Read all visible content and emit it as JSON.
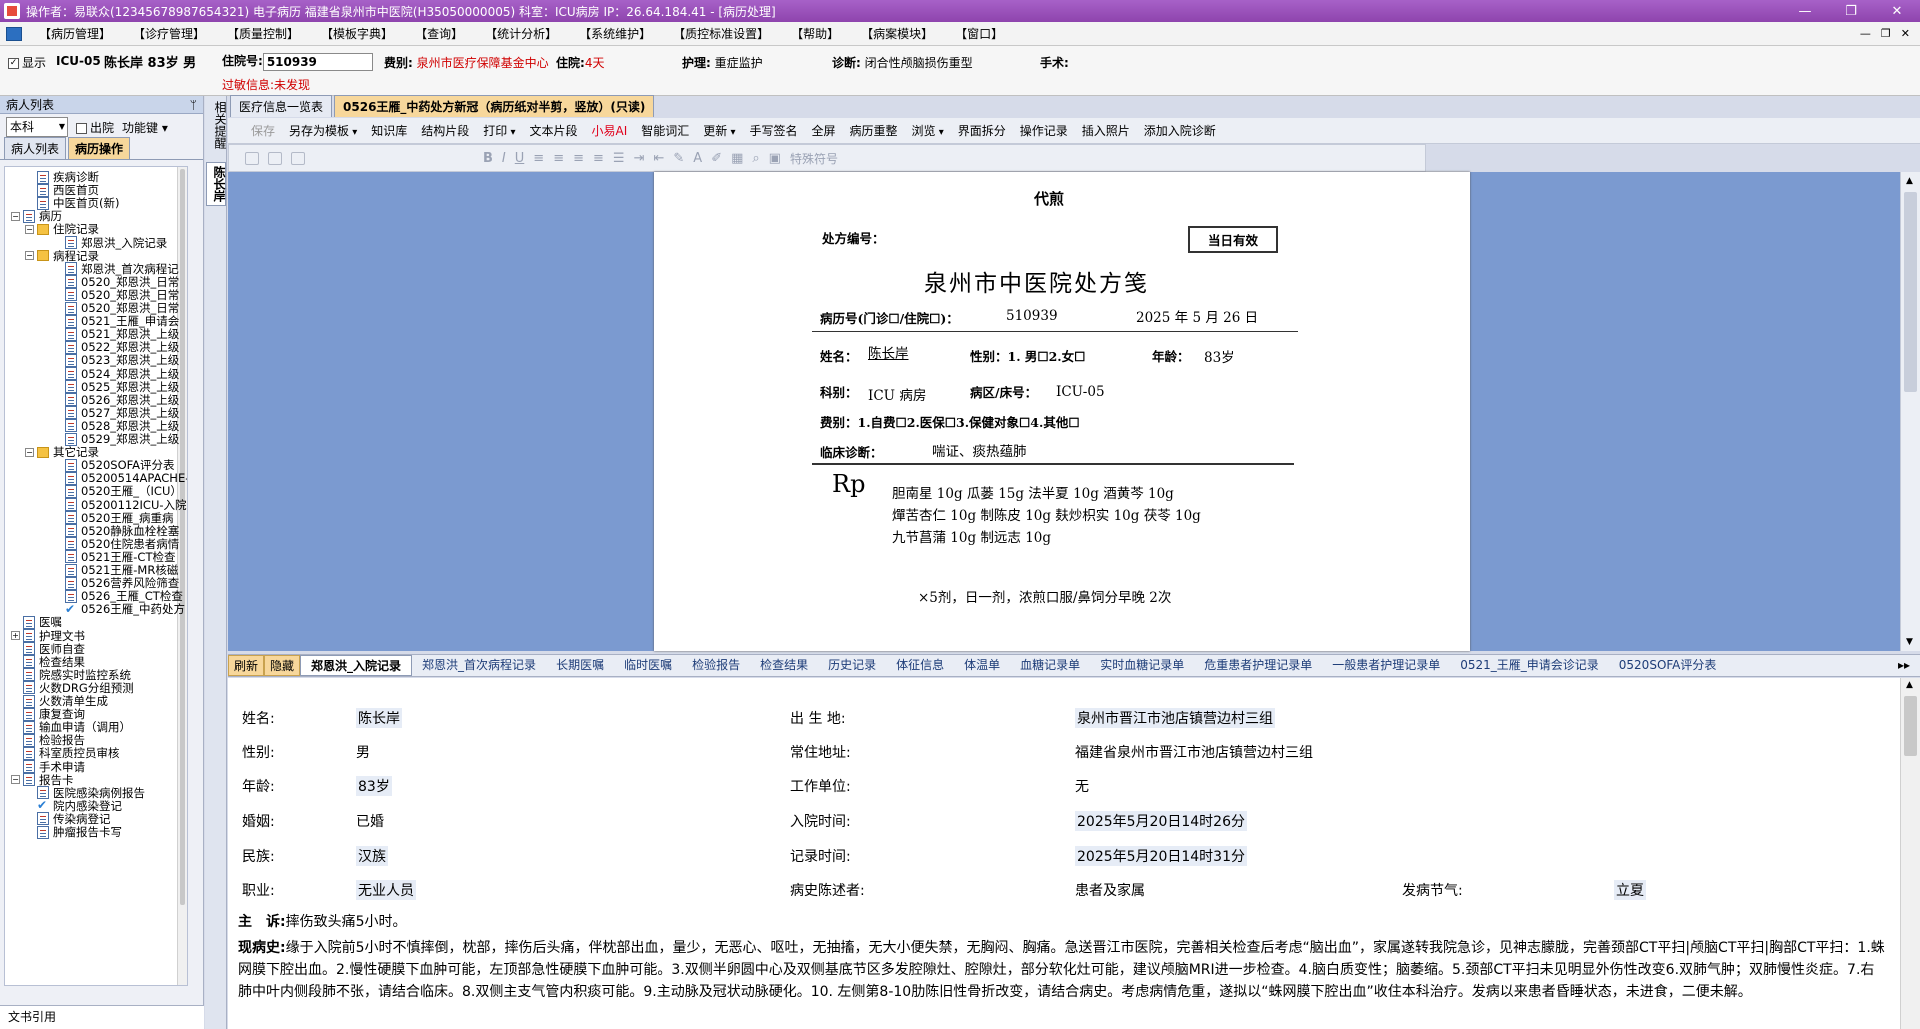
{
  "titlebar": {
    "text": "操作者：易联众(12345678987654321) 电子病历  福建省泉州市中医院(H35050000005)  科室：ICU病房  IP：26.64.184.41 - [病历处理]",
    "min": "—",
    "max": "❐",
    "close": "✕"
  },
  "menu": [
    "【病历管理】",
    "【诊疗管理】",
    "【质量控制】",
    "【模板字典】",
    "【查询】",
    "【统计分析】",
    "【系统维护】",
    "【质控标准设置】",
    "【帮助】",
    "【病案模块】",
    "【窗口】"
  ],
  "menu_right": [
    "—",
    "❐",
    "✕"
  ],
  "patient": {
    "show_label": "显示",
    "bed": "ICU-05",
    "name_age_sex": "陈长岸 83岁 男",
    "zyh_label": "住院号:",
    "zyh": "510939",
    "fb_label": "费别:",
    "fb": "泉州市医疗保障基金中心",
    "zy_label": "住院:",
    "zy_days": "4天",
    "hl_label": "护理:",
    "hl": "重症监护",
    "zd_label": "诊断:",
    "zd": "闭合性颅脑损伤重型",
    "ss_label": "手术:",
    "gm_label": "过敏信息:",
    "gm": "未发现"
  },
  "left": {
    "header": "病人列表",
    "pin": "ᛘ",
    "dept": "本科",
    "discharged": "出院",
    "funckey": "功能键",
    "tabs": [
      "病人列表",
      "病历操作"
    ],
    "tree": [
      {
        "label": "疾病诊断",
        "lv": 1,
        "icon": "doc"
      },
      {
        "label": "西医首页",
        "lv": 1,
        "icon": "doc"
      },
      {
        "label": "中医首页(新)",
        "lv": 1,
        "icon": "doc"
      },
      {
        "label": "病历",
        "lv": 0,
        "icon": "doc",
        "exp": "−"
      },
      {
        "label": "住院记录",
        "lv": 1,
        "icon": "folder",
        "exp": "−"
      },
      {
        "label": "郑恩洪_入院记录",
        "lv": 3,
        "icon": "doc"
      },
      {
        "label": "病程记录",
        "lv": 1,
        "icon": "folder",
        "exp": "−"
      },
      {
        "label": "郑恩洪_首次病程记",
        "lv": 3,
        "icon": "doc"
      },
      {
        "label": "0520_郑恩洪_日常",
        "lv": 3,
        "icon": "doc"
      },
      {
        "label": "0520_郑恩洪_日常",
        "lv": 3,
        "icon": "doc"
      },
      {
        "label": "0520_郑恩洪_日常",
        "lv": 3,
        "icon": "doc"
      },
      {
        "label": "0521_王雁_申请会",
        "lv": 3,
        "icon": "doc"
      },
      {
        "label": "0521_郑恩洪_上级",
        "lv": 3,
        "icon": "doc"
      },
      {
        "label": "0522_郑恩洪_上级",
        "lv": 3,
        "icon": "doc"
      },
      {
        "label": "0523_郑恩洪_上级",
        "lv": 3,
        "icon": "doc"
      },
      {
        "label": "0524_郑恩洪_上级",
        "lv": 3,
        "icon": "doc"
      },
      {
        "label": "0525_郑恩洪_上级",
        "lv": 3,
        "icon": "doc"
      },
      {
        "label": "0526_郑恩洪_上级",
        "lv": 3,
        "icon": "doc"
      },
      {
        "label": "0527_郑恩洪_上级",
        "lv": 3,
        "icon": "doc"
      },
      {
        "label": "0528_郑恩洪_上级",
        "lv": 3,
        "icon": "doc"
      },
      {
        "label": "0529_郑恩洪_上级",
        "lv": 3,
        "icon": "doc"
      },
      {
        "label": "其它记录",
        "lv": 1,
        "icon": "folder",
        "exp": "−"
      },
      {
        "label": "0520SOFA评分表",
        "lv": 3,
        "icon": "doc"
      },
      {
        "label": "05200514APACHE-J",
        "lv": 3,
        "icon": "doc"
      },
      {
        "label": "0520王雁_（ICU）",
        "lv": 3,
        "icon": "doc"
      },
      {
        "label": "05200112ICU-入院",
        "lv": 3,
        "icon": "doc"
      },
      {
        "label": "0520王雁_病重病",
        "lv": 3,
        "icon": "doc"
      },
      {
        "label": "0520静脉血栓栓塞",
        "lv": 3,
        "icon": "doc"
      },
      {
        "label": "0520住院患者病情",
        "lv": 3,
        "icon": "doc"
      },
      {
        "label": "0521王雁-CT检查",
        "lv": 3,
        "icon": "doc"
      },
      {
        "label": "0521王雁-MR核磁",
        "lv": 3,
        "icon": "doc"
      },
      {
        "label": "0526营养风险筛查",
        "lv": 3,
        "icon": "doc"
      },
      {
        "label": "0526_王雁_CT检查",
        "lv": 3,
        "icon": "doc"
      },
      {
        "label": "0526王雁_中药处方",
        "lv": 3,
        "icon": "check"
      },
      {
        "label": "医嘱",
        "lv": 0,
        "icon": "doc"
      },
      {
        "label": "护理文书",
        "lv": 0,
        "icon": "doc",
        "exp": "+"
      },
      {
        "label": "医师自查",
        "lv": 0,
        "icon": "doc"
      },
      {
        "label": "检查结果",
        "lv": 0,
        "icon": "doc"
      },
      {
        "label": "院感实时监控系统",
        "lv": 0,
        "icon": "doc"
      },
      {
        "label": "火数DRG分组预测",
        "lv": 0,
        "icon": "doc"
      },
      {
        "label": "火数清单生成",
        "lv": 0,
        "icon": "doc"
      },
      {
        "label": "康复查询",
        "lv": 0,
        "icon": "doc"
      },
      {
        "label": "输血申请（调用）",
        "lv": 0,
        "icon": "doc"
      },
      {
        "label": "检验报告",
        "lv": 0,
        "icon": "doc"
      },
      {
        "label": "科室质控员审核",
        "lv": 0,
        "icon": "doc"
      },
      {
        "label": "手术申请",
        "lv": 0,
        "icon": "doc"
      },
      {
        "label": "报告卡",
        "lv": 0,
        "icon": "doc",
        "exp": "−"
      },
      {
        "label": "医院感染病例报告",
        "lv": 1,
        "icon": "doc"
      },
      {
        "label": "院内感染登记",
        "lv": 1,
        "icon": "check"
      },
      {
        "label": "传染病登记",
        "lv": 1,
        "icon": "doc"
      },
      {
        "label": "肿瘤报告卡写",
        "lv": 1,
        "icon": "doc"
      }
    ],
    "bottom": "文书引用"
  },
  "vtabs": [
    "相关提醒",
    "陈长岸"
  ],
  "doctabs": [
    "医疗信息一览表",
    "0526王雁_中药处方新冠（病历纸对半剪，竖放）(只读)"
  ],
  "toolbar1": [
    {
      "l": "保存",
      "dis": true
    },
    {
      "l": "另存为模板",
      "dd": true
    },
    {
      "l": "知识库"
    },
    {
      "l": "结构片段"
    },
    {
      "l": "打印",
      "dd": true
    },
    {
      "l": "文本片段"
    },
    {
      "l": "小易AI",
      "red": true
    },
    {
      "l": "智能词汇"
    },
    {
      "l": "更新",
      "dd": true
    },
    {
      "l": "手写签名"
    },
    {
      "l": "全屏"
    },
    {
      "l": "病历重整"
    },
    {
      "l": "浏览",
      "dd": true
    },
    {
      "l": "界面拆分"
    },
    {
      "l": "操作记录"
    },
    {
      "l": "插入照片"
    },
    {
      "l": "添加入院诊断"
    }
  ],
  "toolbar2_special": "特殊符号",
  "rx": {
    "daijian": "代煎",
    "no_label": "处方编号：",
    "valid": "当日有效",
    "hospital": "泉州市中医院处方笺",
    "mrn_label": "病历号(门诊☐/住院☐)：",
    "mrn": "510939",
    "date": "2025 年 5 月 26 日",
    "name_label": "姓名：",
    "name": "陈长岸",
    "sex_label": "性别：1. 男☐2.女☐",
    "age_label": "年龄：",
    "age": "83岁",
    "dept_label": "科别：",
    "dept": "ICU 病房",
    "bed_label": "病区/床号：",
    "bed": "ICU-05",
    "fee": "费别：1.自费☐2.医保☐3.保健对象☐4.其他☐",
    "diag_label": "临床诊断：",
    "diag": "喘证、痰热蕴肺",
    "rp": "Rp",
    "herbs1": "胆南星 10g    瓜蒌 15g   法半夏 10g     酒黄芩 10g",
    "herbs2": "燀苦杏仁 10g   制陈皮 10g   麸炒枳实 10g  茯苓 10g",
    "herbs3": "九节菖蒲 10g    制远志 10g",
    "usage": "×5剂，日一剂，浓煎口服/鼻饲分早晚 2次"
  },
  "rectabs": [
    "刷新",
    "隐藏",
    "郑恩洪_入院记录",
    "郑恩洪_首次病程记录",
    "长期医嘱",
    "临时医嘱",
    "检验报告",
    "检查结果",
    "历史记录",
    "体征信息",
    "体温单",
    "血糖记录单",
    "实时血糖记录单",
    "危重患者护理记录单",
    "一般患者护理记录单",
    "0521_王雁_申请会诊记录",
    "0520SOFA评分表"
  ],
  "rectabs_arrow": "▸▸",
  "record": {
    "name_l": "姓名:",
    "name": "陈长岸",
    "birth_l": "出 生 地:",
    "birth": "泉州市晋江市池店镇营边村三组",
    "sex_l": "性别:",
    "sex": "男",
    "addr_l": "常住地址:",
    "addr": "福建省泉州市晋江市池店镇营边村三组",
    "age_l": "年龄:",
    "age": "83岁",
    "work_l": "工作单位:",
    "work": "无",
    "mar_l": "婚姻:",
    "mar": "已婚",
    "adm_l": "入院时间:",
    "adm": "2025年5月20日14时26分",
    "nat_l": "民族:",
    "nat": "汉族",
    "rec_l": "记录时间:",
    "rec": "2025年5月20日14时31分",
    "job_l": "职业:",
    "job": "无业人员",
    "hist_l": "病史陈述者:",
    "hist": "患者及家属",
    "term_l": "发病节气:",
    "term": "立夏",
    "cc_l": "主　诉:",
    "cc": "摔伤致头痛5小时。",
    "hpi_l": "现病史:",
    "hpi": "缘于入院前5小时不慎摔倒，枕部，摔伤后头痛，伴枕部出血，量少，无恶心、呕吐，无抽搐，无大小便失禁，无胸闷、胸痛。急送晋江市医院，完善相关检查后考虑“脑出血”，家属遂转我院急诊，见神志朦胧，完善颈部CT平扫|颅脑CT平扫|胸部CT平扫：1.蛛网膜下腔出血。2.慢性硬膜下血肿可能，左顶部急性硬膜下血肿可能。3.双侧半卵圆中心及双侧基底节区多发腔隙灶、腔隙灶，部分软化灶可能，建议颅脑MRI进一步检查。4.脑白质变性；脑萎缩。5.颈部CT平扫未见明显外伤性改变6.双肺气肿；双肺慢性炎症。7.右肺中叶内侧段肺不张，请结合临床。8.双侧主支气管内积痰可能。9.主动脉及冠状动脉硬化。10. 左侧第8-10肋陈旧性骨折改变，请结合病史。考虑病情危重，遂拟以“蛛网膜下腔出血”收住本科治疗。发病以来患者昏睡状态，未进食，二便未解。"
  }
}
